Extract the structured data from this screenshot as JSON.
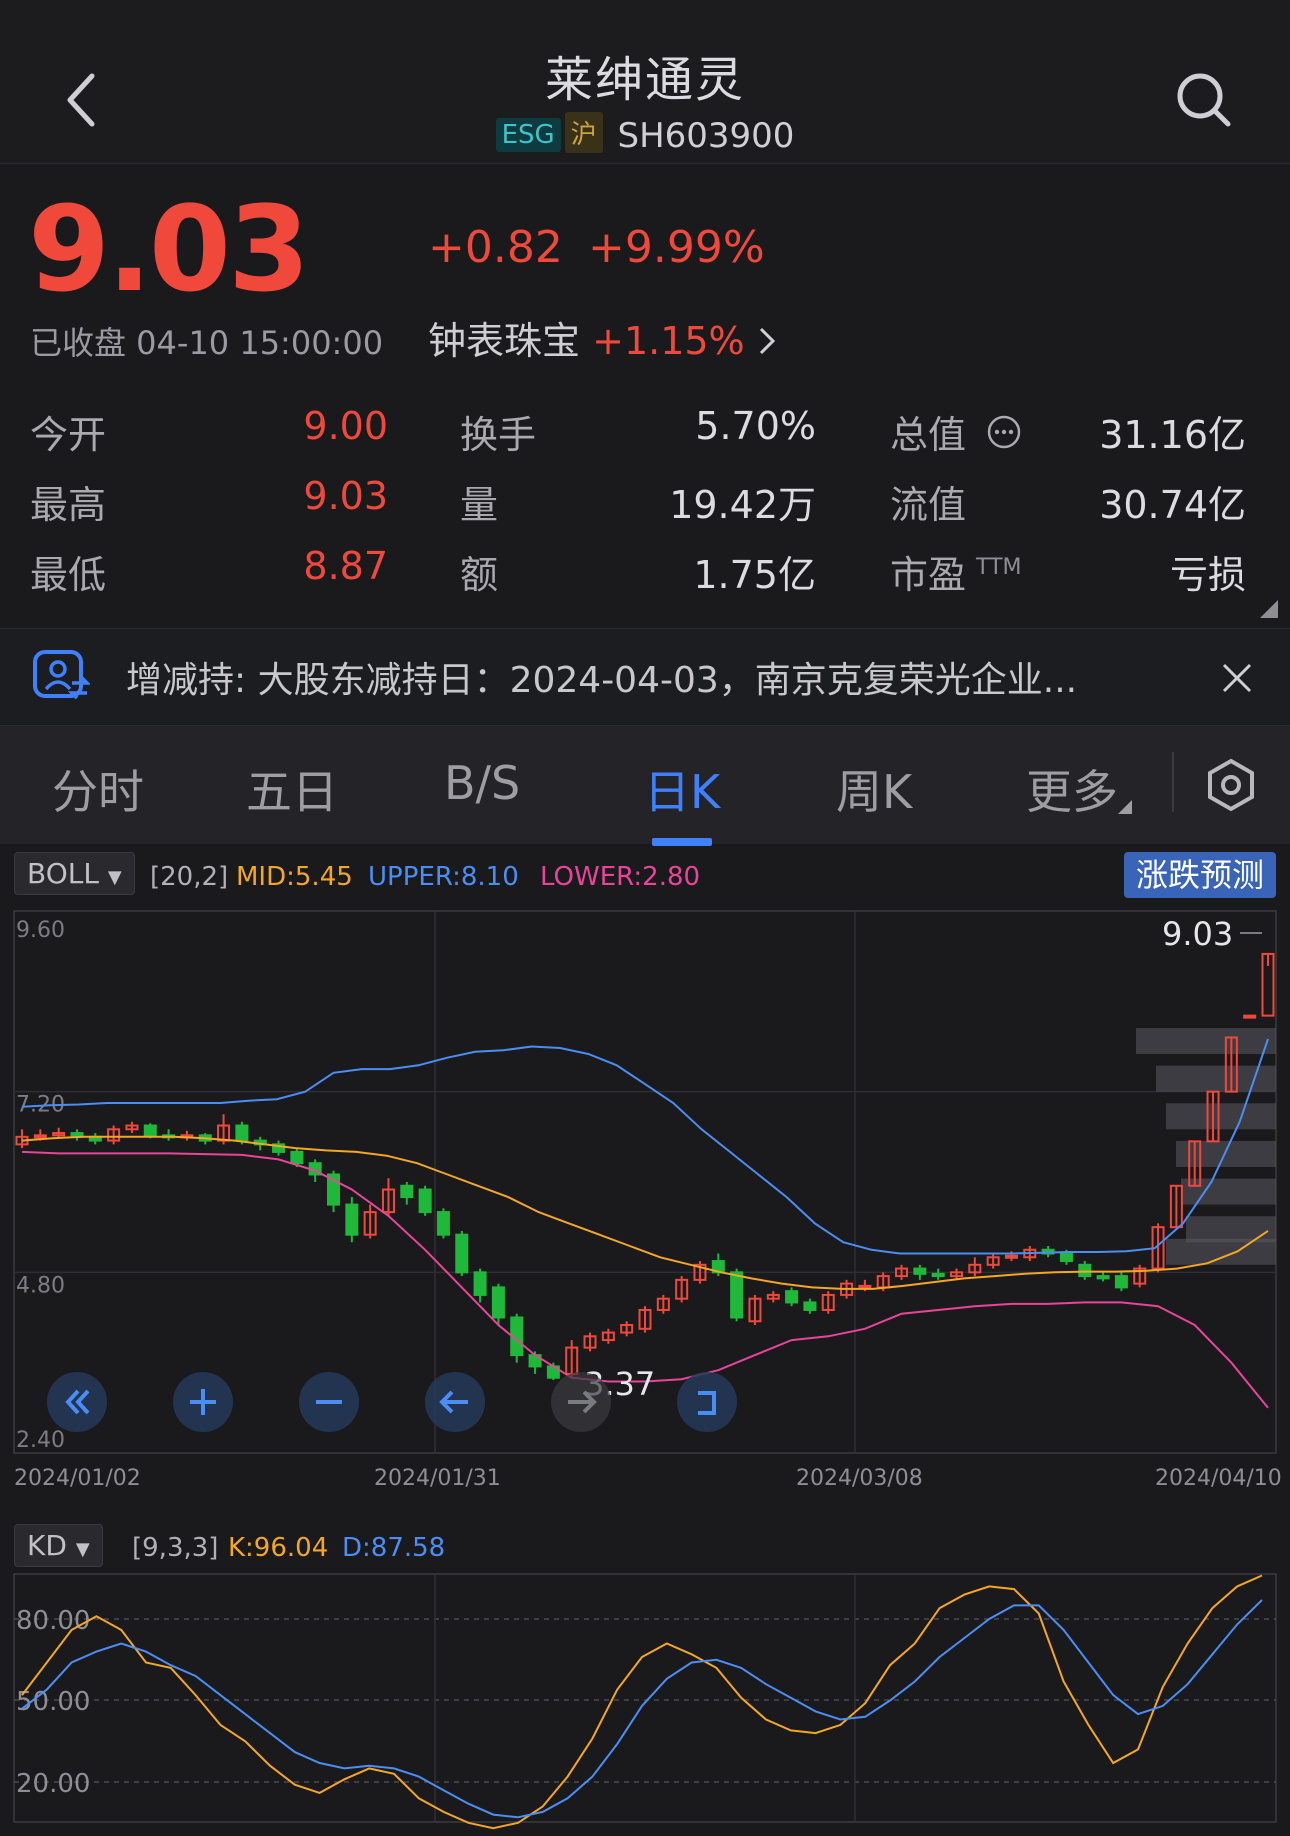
{
  "header": {
    "title": "莱绅通灵",
    "badge_esg": "ESG",
    "badge_market": "沪",
    "code": "SH603900"
  },
  "quote": {
    "price": "9.03",
    "change": "+0.82",
    "change_pct": "+9.99%",
    "status": "已收盘 04-10 15:00:00",
    "sector_name": "钟表珠宝",
    "sector_pct": "+1.15%"
  },
  "stats": [
    {
      "label": "今开",
      "value": "9.00"
    },
    {
      "label": "换手",
      "value": "5.70%"
    },
    {
      "label": "总值",
      "value": "31.16亿"
    },
    {
      "label": "最高",
      "value": "9.03"
    },
    {
      "label": "量",
      "value": "19.42万"
    },
    {
      "label": "流值",
      "value": "30.74亿"
    },
    {
      "label": "最低",
      "value": "8.87"
    },
    {
      "label": "额",
      "value": "1.75亿"
    },
    {
      "label": "市盈",
      "value": "亏损"
    }
  ],
  "stats_extra": {
    "ttm": "TTM"
  },
  "notice": {
    "text": "增减持: 大股东减持日：2024-04-03，南京克复荣光企业..."
  },
  "tabs": [
    "分时",
    "五日",
    "B/S",
    "日K",
    "周K",
    "更多"
  ],
  "active_tab": "日K",
  "colors": {
    "red": "#f0493b",
    "green": "#1fb83a",
    "accent": "#3f80ff",
    "mid": "#f5a623",
    "upper": "#4a8ef5",
    "lower": "#e8449a"
  },
  "boll": {
    "selector": "BOLL",
    "params": "[20,2]",
    "mid": "MID:5.45",
    "upper": "UPPER:8.10",
    "lower": "LOWER:2.80",
    "predict": "涨跌预测"
  },
  "kd": {
    "selector": "KD",
    "params": "[9,3,3]",
    "k": "K:96.04",
    "d": "D:87.58"
  },
  "chart_data": [
    {
      "type": "candlestick",
      "y_ticks": [
        "9.60",
        "7.20",
        "4.80",
        "2.40"
      ],
      "ylim": [
        2.4,
        9.6
      ],
      "x_ticks": [
        "2024/01/02",
        "2024/01/31",
        "2024/03/08",
        "2024/04/10"
      ],
      "high_label": "9.03",
      "low_label": "3.37",
      "candles": [
        [
          6.5,
          6.6,
          6.7,
          6.45
        ],
        [
          6.6,
          6.62,
          6.7,
          6.55
        ],
        [
          6.62,
          6.65,
          6.72,
          6.58
        ],
        [
          6.65,
          6.6,
          6.7,
          6.55
        ],
        [
          6.6,
          6.55,
          6.65,
          6.5
        ],
        [
          6.55,
          6.7,
          6.75,
          6.5
        ],
        [
          6.7,
          6.75,
          6.8,
          6.65
        ],
        [
          6.75,
          6.62,
          6.78,
          6.58
        ],
        [
          6.62,
          6.6,
          6.7,
          6.55
        ],
        [
          6.6,
          6.62,
          6.68,
          6.55
        ],
        [
          6.62,
          6.55,
          6.65,
          6.5
        ],
        [
          6.55,
          6.75,
          6.9,
          6.5
        ],
        [
          6.75,
          6.55,
          6.8,
          6.5
        ],
        [
          6.55,
          6.5,
          6.6,
          6.42
        ],
        [
          6.5,
          6.4,
          6.55,
          6.35
        ],
        [
          6.4,
          6.25,
          6.45,
          6.2
        ],
        [
          6.25,
          6.1,
          6.3,
          6.0
        ],
        [
          6.1,
          5.7,
          6.15,
          5.6
        ],
        [
          5.7,
          5.3,
          5.8,
          5.2
        ],
        [
          5.3,
          5.6,
          5.7,
          5.25
        ],
        [
          5.6,
          5.9,
          6.05,
          5.55
        ],
        [
          5.95,
          5.8,
          6.0,
          5.7
        ],
        [
          5.9,
          5.6,
          5.95,
          5.55
        ],
        [
          5.6,
          5.3,
          5.65,
          5.25
        ],
        [
          5.3,
          4.8,
          5.35,
          4.75
        ],
        [
          4.8,
          4.5,
          4.85,
          4.4
        ],
        [
          4.6,
          4.2,
          4.65,
          4.1
        ],
        [
          4.2,
          3.7,
          4.25,
          3.6
        ],
        [
          3.7,
          3.55,
          3.75,
          3.45
        ],
        [
          3.55,
          3.4,
          3.6,
          3.37
        ],
        [
          3.45,
          3.8,
          3.9,
          3.4
        ],
        [
          3.8,
          3.95,
          4.0,
          3.75
        ],
        [
          3.9,
          4.0,
          4.05,
          3.85
        ],
        [
          4.0,
          4.1,
          4.15,
          3.95
        ],
        [
          4.05,
          4.3,
          4.35,
          4.0
        ],
        [
          4.3,
          4.45,
          4.5,
          4.25
        ],
        [
          4.45,
          4.7,
          4.75,
          4.4
        ],
        [
          4.7,
          4.9,
          4.95,
          4.65
        ],
        [
          4.95,
          4.8,
          5.05,
          4.75
        ],
        [
          4.8,
          4.2,
          4.85,
          4.15
        ],
        [
          4.15,
          4.45,
          4.5,
          4.1
        ],
        [
          4.45,
          4.5,
          4.55,
          4.4
        ],
        [
          4.55,
          4.4,
          4.6,
          4.35
        ],
        [
          4.4,
          4.3,
          4.45,
          4.25
        ],
        [
          4.3,
          4.5,
          4.55,
          4.25
        ],
        [
          4.5,
          4.65,
          4.7,
          4.45
        ],
        [
          4.6,
          4.62,
          4.7,
          4.55
        ],
        [
          4.6,
          4.75,
          4.8,
          4.55
        ],
        [
          4.75,
          4.85,
          4.9,
          4.7
        ],
        [
          4.85,
          4.78,
          4.9,
          4.7
        ],
        [
          4.78,
          4.75,
          4.85,
          4.7
        ],
        [
          4.75,
          4.8,
          4.85,
          4.7
        ],
        [
          4.8,
          4.9,
          5.0,
          4.75
        ],
        [
          4.9,
          5.0,
          5.05,
          4.85
        ],
        [
          5.0,
          5.02,
          5.08,
          4.95
        ],
        [
          5.0,
          5.1,
          5.15,
          4.95
        ],
        [
          5.1,
          5.05,
          5.15,
          5.0
        ],
        [
          5.05,
          4.95,
          5.1,
          4.9
        ],
        [
          4.9,
          4.75,
          4.95,
          4.7
        ],
        [
          4.75,
          4.72,
          4.8,
          4.68
        ],
        [
          4.75,
          4.6,
          4.8,
          4.55
        ],
        [
          4.65,
          4.85,
          4.9,
          4.6
        ],
        [
          4.85,
          5.4,
          5.45,
          4.8
        ],
        [
          5.4,
          5.95,
          5.95,
          5.4
        ],
        [
          5.95,
          6.54,
          6.54,
          5.95
        ],
        [
          6.54,
          7.2,
          7.2,
          6.54
        ],
        [
          7.2,
          7.92,
          7.92,
          7.2
        ],
        [
          8.21,
          8.21,
          8.21,
          8.21
        ],
        [
          8.21,
          9.03,
          9.03,
          8.87
        ]
      ],
      "upper": [
        7.0,
        7.02,
        7.03,
        7.05,
        7.05,
        7.05,
        7.05,
        7.05,
        7.08,
        7.1,
        7.2,
        7.45,
        7.5,
        7.5,
        7.55,
        7.65,
        7.73,
        7.75,
        7.8,
        7.78,
        7.7,
        7.55,
        7.3,
        7.05,
        6.7,
        6.4,
        6.1,
        5.8,
        5.45,
        5.2,
        5.1,
        5.05,
        5.05,
        5.05,
        5.05,
        5.05,
        5.06,
        5.07,
        5.07,
        5.08,
        5.12,
        5.45,
        6.0,
        6.8,
        7.9
      ],
      "mid": [
        6.55,
        6.58,
        6.6,
        6.6,
        6.6,
        6.6,
        6.58,
        6.55,
        6.5,
        6.45,
        6.42,
        6.4,
        6.35,
        6.25,
        6.1,
        5.95,
        5.8,
        5.6,
        5.45,
        5.3,
        5.15,
        5.0,
        4.9,
        4.8,
        4.72,
        4.65,
        4.6,
        4.58,
        4.58,
        4.62,
        4.67,
        4.72,
        4.75,
        4.78,
        4.8,
        4.81,
        4.81,
        4.82,
        4.85,
        4.92,
        5.08,
        5.35
      ],
      "lower": [
        6.4,
        6.38,
        6.38,
        6.38,
        6.38,
        6.37,
        6.36,
        6.3,
        6.15,
        5.9,
        5.55,
        5.1,
        4.6,
        4.1,
        3.7,
        3.4,
        3.35,
        3.35,
        3.38,
        3.5,
        3.7,
        3.9,
        3.95,
        4.05,
        4.25,
        4.3,
        4.35,
        4.38,
        4.38,
        4.4,
        4.4,
        4.35,
        4.1,
        3.6,
        3.0
      ]
    },
    {
      "type": "line",
      "y_ticks": [
        "80.00",
        "50.00",
        "20.00"
      ],
      "ylim": [
        0,
        100
      ],
      "series": [
        {
          "name": "K",
          "values": [
            52,
            64,
            76,
            81,
            76,
            64,
            62,
            52,
            41,
            35,
            26,
            19,
            16,
            21,
            25,
            23,
            14,
            9,
            5,
            3,
            5,
            11,
            22,
            36,
            54,
            66,
            71,
            67,
            62,
            51,
            43,
            39,
            38,
            41,
            49,
            63,
            71,
            84,
            89,
            92,
            91,
            82,
            57,
            41,
            27,
            32,
            55,
            71,
            84,
            92,
            96
          ]
        },
        {
          "name": "D",
          "values": [
            47,
            54,
            64,
            68,
            71,
            68,
            63,
            59,
            52,
            45,
            38,
            31,
            27,
            25,
            26,
            25,
            22,
            17,
            12,
            8,
            7,
            9,
            14,
            22,
            34,
            48,
            58,
            64,
            65,
            62,
            56,
            51,
            46,
            43,
            44,
            50,
            57,
            66,
            73,
            80,
            85,
            85,
            76,
            64,
            52,
            45,
            48,
            56,
            67,
            78,
            87
          ]
        }
      ]
    }
  ]
}
